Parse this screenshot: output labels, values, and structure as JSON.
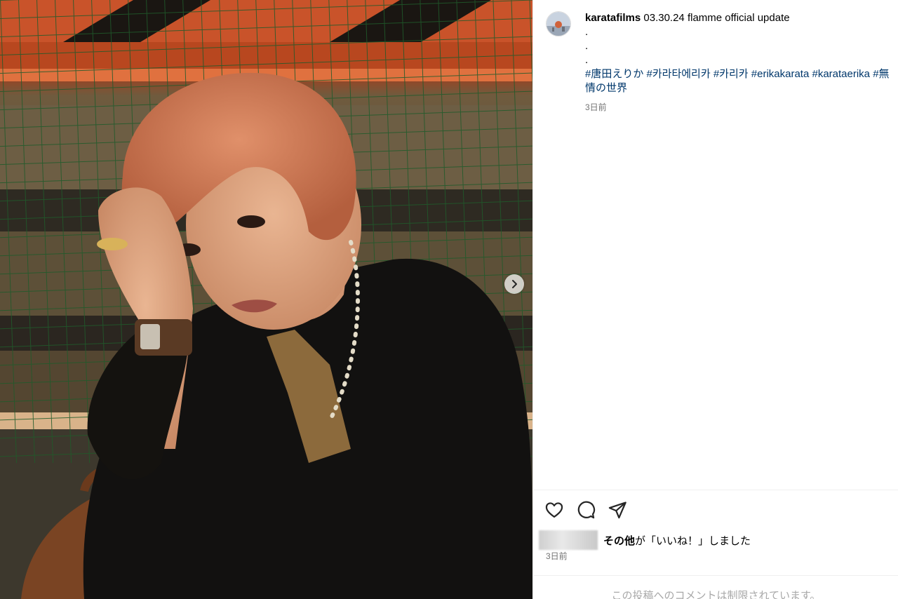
{
  "post": {
    "username": "karatafilms",
    "caption": "03.30.24 flamme official update",
    "dots": [
      ".",
      ".",
      "."
    ],
    "hashtags": [
      "#唐田えりか",
      "#카라타에리카",
      "#카리카",
      "#erikakarata",
      "#karataerika",
      "#無情の世界"
    ],
    "time_ago": "3日前"
  },
  "likes": {
    "bold": "その他",
    "rest": "が「いいね！」しました"
  },
  "post_date": "3日前",
  "comments_note": "この投稿へのコメントは制限されています。",
  "icons": {
    "like": "heart-icon",
    "comment": "comment-icon",
    "share": "send-icon",
    "next": "chevron-right-icon"
  },
  "colors": {
    "hashtag": "#00376b",
    "secondary_text": "#737373"
  }
}
